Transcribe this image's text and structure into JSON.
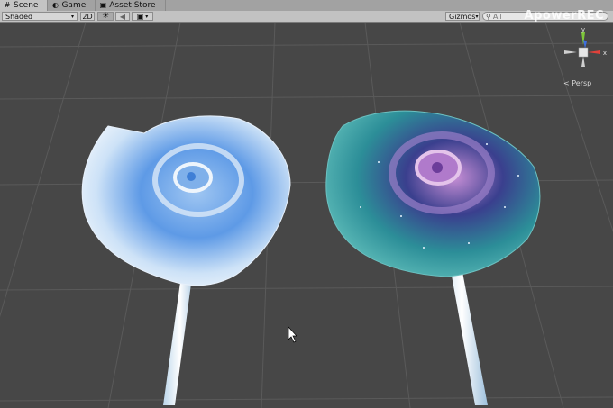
{
  "tabs": [
    {
      "label": "Scene",
      "icon": "scene-icon",
      "active": true
    },
    {
      "label": "Game",
      "icon": "game-icon",
      "active": false
    },
    {
      "label": "Asset Store",
      "icon": "asset-store-icon",
      "active": false
    }
  ],
  "toolbar": {
    "shading_mode": "Shaded",
    "mode_2d_label": "2D",
    "gizmos_label": "Gizmos",
    "search_placeholder": "All"
  },
  "watermark": "ApowerREC",
  "scene_gizmo": {
    "y_axis_label": "y",
    "x_axis_label": "x",
    "projection_label": "Persp"
  },
  "colors": {
    "viewport_bg": "#474747",
    "toolbar_bg": "#c2c2c2",
    "axis_x": "#e0413a",
    "axis_y": "#7ec73a",
    "axis_z": "#3d6ee0"
  }
}
